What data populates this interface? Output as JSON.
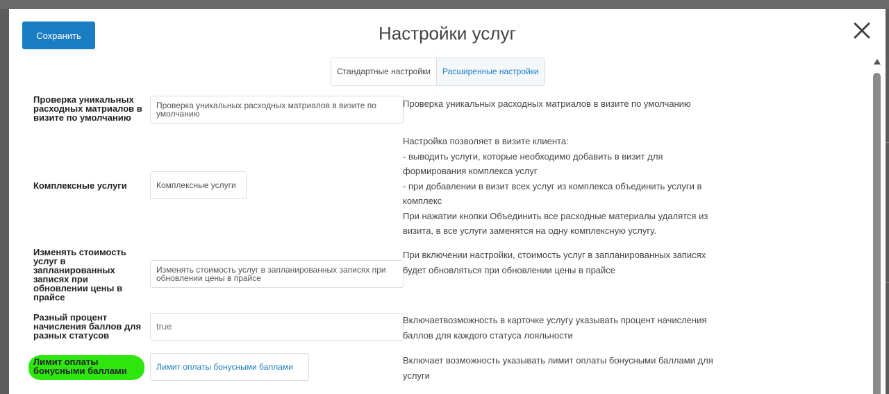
{
  "modal": {
    "title": "Настройки услуг",
    "save_label": "Сохранить",
    "close_icon": "close-icon"
  },
  "tabs": [
    {
      "label": "Стандартные настройки",
      "active": false
    },
    {
      "label": "Расширенные настройки",
      "active": true
    }
  ],
  "settings": [
    {
      "label": "Проверка уникальных расходных матриалов в визите по умолчанию",
      "field_value": "Проверка уникальных расходных матриалов в визите по умолчанию",
      "description": [
        "Проверка уникальных расходных матриалов в визите по умолчанию"
      ]
    },
    {
      "label": "Комплексные услуги",
      "field_value": "Комплексные услуги",
      "description": [
        "Настройка позволяет в визите клиента:",
        "- выводить услуги, которые необходимо добавить в визит для",
        "формирования комплекса услуг",
        "- при добавлении в визит всех услуг из комплекса объединить услуги в",
        "комплекс",
        "При нажатии кнопки Объединить все расходные материалы удалятся из",
        "визита, в все услуги заменятся на одну комплексную услугу."
      ]
    },
    {
      "label": "Изменять стоимость услуг в запланированных записях при обновлении цены в прайсе",
      "field_value": "Изменять стоимость услуг в запланированных записях при обновлении цены в прайсе",
      "description": [
        "При включении настройки, стоимость услуг в запланированных записях",
        "будет обновляться при обновлении цены в прайсе"
      ]
    },
    {
      "label": "Разный процент начисления баллов для разных статусов",
      "field_value": "true",
      "description": [
        "Включаетвозможность в карточке услугу указывать процент начисления",
        "баллов для каждого статуса лояльности"
      ]
    },
    {
      "label": "Лимит оплаты бонусными баллами",
      "field_value": "Лимит оплаты бонусными баллами",
      "description": [
        "Включает возможность указывать лимит оплаты бонусными баллами для",
        "услуги"
      ]
    }
  ],
  "colors": {
    "primary": "#1a7dc4",
    "highlight": "#2ee60e",
    "backdrop": "#5c5c5c"
  }
}
